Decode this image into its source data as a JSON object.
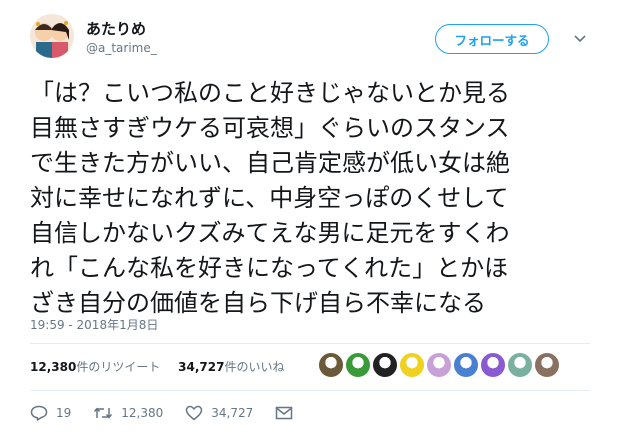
{
  "user": {
    "display_name": "あたりめ",
    "handle": "@a_tarime_"
  },
  "follow_button": "フォローする",
  "tweet": {
    "lines": [
      "「は？こいつ私のこと好きじゃないとか見る",
      "目無さすぎウケる可哀想」ぐらいのスタンス",
      "で生きた方がいい、自己肯定感が低い女は絶",
      "対に幸せになれずに、中身空っぽのくせして",
      "自信しかないクズみてえな男に足元をすくわ",
      "れ「こんな私を好きになってくれた」とかほ",
      "ざき自分の価値を自ら下げ自ら不幸になる"
    ],
    "timestamp": "19:59 - 2018年1月8日"
  },
  "stats": {
    "retweets_count": "12,380",
    "retweets_label": "件のリツイート",
    "likes_count": "34,727",
    "likes_label": "件のいいね"
  },
  "liker_colors": [
    "#6b5a3a",
    "#3a9a3a",
    "#222222",
    "#f0d020",
    "#c8a0d8",
    "#4a80d0",
    "#8a5ad0",
    "#7ab0a0",
    "#8a7060"
  ],
  "actions": {
    "reply_count": "19",
    "retweet_count": "12,380",
    "like_count": "34,727"
  }
}
